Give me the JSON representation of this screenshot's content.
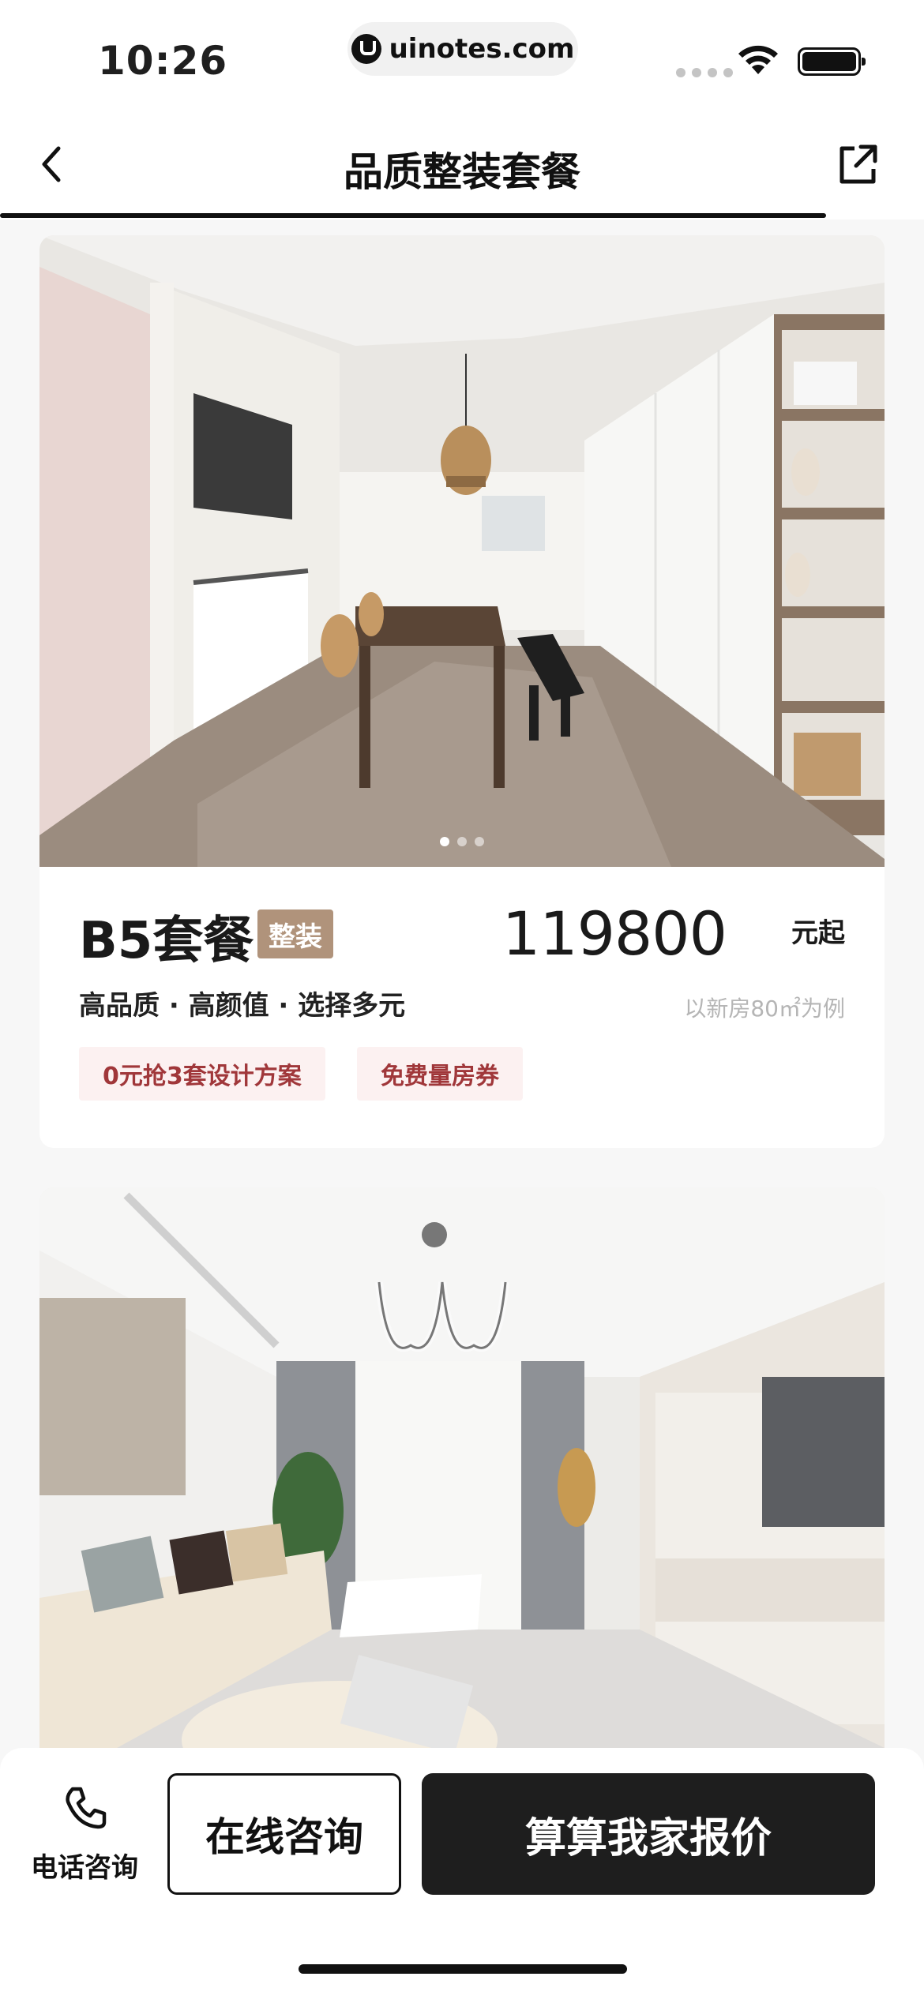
{
  "status_bar": {
    "time": "10:26",
    "url": "uinotes.com"
  },
  "nav": {
    "title": "品质整装套餐"
  },
  "carousel": {
    "total": 3,
    "active_index": 0
  },
  "package": {
    "name": "B5套餐",
    "badge": "整装",
    "price": "119800",
    "price_unit": "元起",
    "features": "高品质 · 高颜值 · 选择多元",
    "price_note": "以新房80㎡为例",
    "tags": [
      "0元抢3套设计方案",
      "免费量房券"
    ]
  },
  "bottom_bar": {
    "phone_label": "电话咨询",
    "consult_label": "在线咨询",
    "quote_label": "算算我家报价"
  },
  "icons": {
    "back": "chevron-left-icon",
    "share": "share-external-icon",
    "phone": "phone-icon"
  }
}
